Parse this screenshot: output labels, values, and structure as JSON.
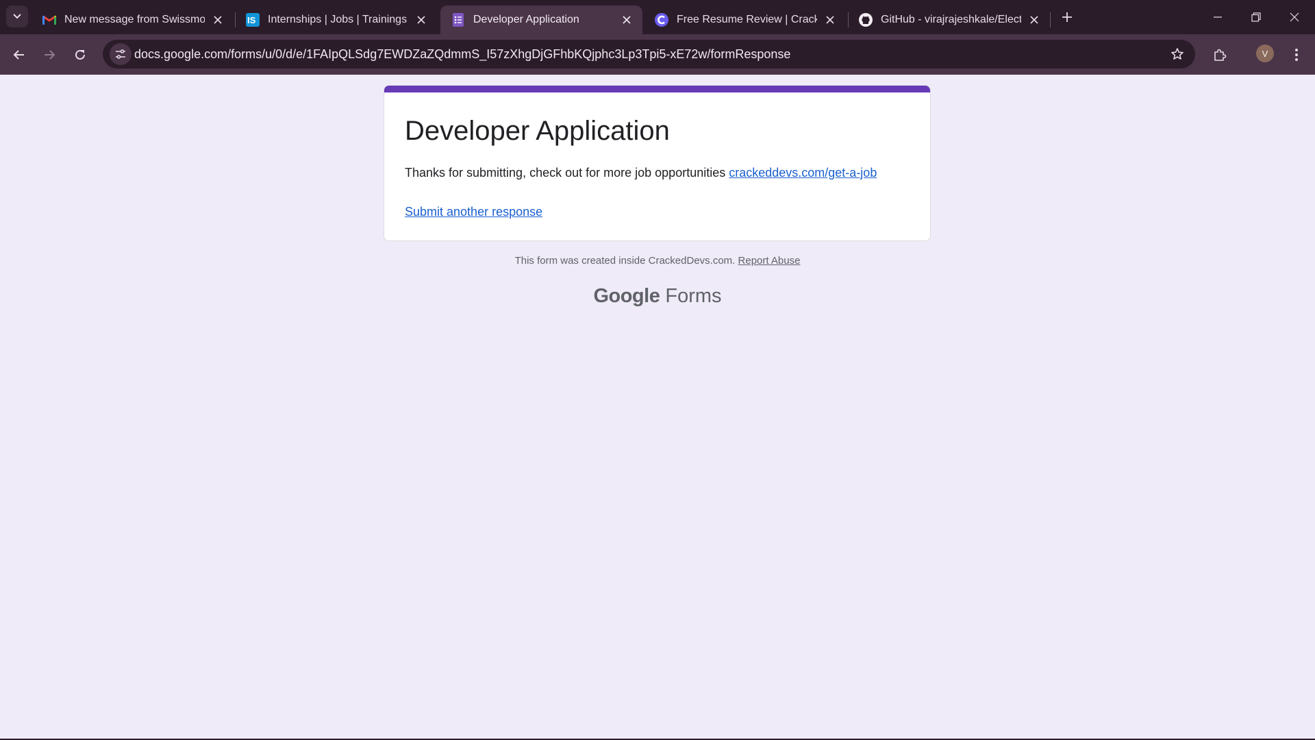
{
  "browser": {
    "tabs": [
      {
        "title": "New message from Swissmote,",
        "icon": "gmail-icon",
        "active": false
      },
      {
        "title": "Internships | Jobs | Trainings & I",
        "icon": "internshala-icon",
        "active": false
      },
      {
        "title": "Developer Application",
        "icon": "google-forms-icon",
        "active": true
      },
      {
        "title": "Free Resume Review | CrackedD",
        "icon": "crackeddevs-icon",
        "active": false
      },
      {
        "title": "GitHub - virajrajeshkale/Electro",
        "icon": "github-icon",
        "active": false
      }
    ],
    "url": "docs.google.com/forms/u/0/d/e/1FAIpQLSdg7EWDZaZQdmmS_I57zXhgDjGFhbKQjphc3Lp3Tpi5-xE72w/formResponse",
    "profile_initial": "V",
    "accent": "#673ab7"
  },
  "form": {
    "title": "Developer Application",
    "message": "Thanks for submitting, check out for more job opportunities ",
    "link_text": "crackeddevs.com/get-a-job",
    "submit_another": "Submit another response"
  },
  "footer": {
    "created_text": "This form was created inside CrackedDevs.com. ",
    "report_abuse": "Report Abuse",
    "brand_google": "Google",
    "brand_forms": "Forms"
  }
}
